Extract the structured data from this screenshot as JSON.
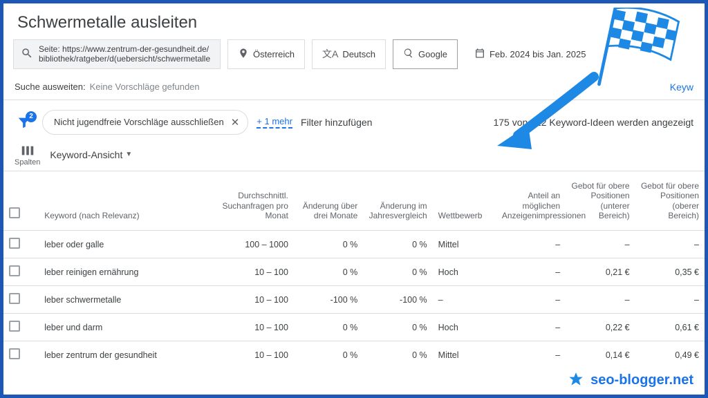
{
  "page_title": "Schwermetalle ausleiten",
  "filters": {
    "site_prefix": "Seite: ",
    "site_url": "https://www.zentrum-der-gesundheit.de/bibliothek/ratgeber/d(uebersicht/schwermetalle",
    "country": "Österreich",
    "language": "Deutsch",
    "network": "Google",
    "date_range": "Feb. 2024 bis Jan. 2025"
  },
  "expand": {
    "label": "Suche ausweiten:",
    "value": "Keine Vorschläge gefunden",
    "right_link": "Keyw"
  },
  "chips": {
    "funnel_count": "2",
    "adult_filter": "Nicht jugendfreie Vorschläge ausschließen",
    "more": "+ 1 mehr",
    "add_filter": "Filter hinzufügen",
    "count_text": "175 von 222 Keyword-Ideen werden angezeigt"
  },
  "view": {
    "columns_label": "Spalten",
    "dropdown_label": "Keyword-Ansicht"
  },
  "table": {
    "headers": {
      "keyword": "Keyword (nach Relevanz)",
      "volume": "Durchschnittl. Suchanfragen pro Monat",
      "change3m": "Änderung über drei Monate",
      "changeYoY": "Änderung im Jahresvergleich",
      "competition": "Wettbewerb",
      "impr_share": "Anteil an möglichen Anzeigenimpressionen",
      "bid_low": "Gebot für obere Positionen (unterer Bereich)",
      "bid_high": "Gebot für obere Positionen (oberer Bereich)"
    },
    "rows": [
      {
        "keyword": "leber oder galle",
        "volume": "100 – 1000",
        "change3m": "0 %",
        "changeYoY": "0 %",
        "competition": "Mittel",
        "impr_share": "–",
        "bid_low": "–",
        "bid_high": "–"
      },
      {
        "keyword": "leber reinigen ernährung",
        "volume": "10 – 100",
        "change3m": "0 %",
        "changeYoY": "0 %",
        "competition": "Hoch",
        "impr_share": "–",
        "bid_low": "0,21 €",
        "bid_high": "0,35 €"
      },
      {
        "keyword": "leber schwermetalle",
        "volume": "10 – 100",
        "change3m": "-100 %",
        "changeYoY": "-100 %",
        "competition": "–",
        "impr_share": "–",
        "bid_low": "–",
        "bid_high": "–"
      },
      {
        "keyword": "leber und darm",
        "volume": "10 – 100",
        "change3m": "0 %",
        "changeYoY": "0 %",
        "competition": "Hoch",
        "impr_share": "–",
        "bid_low": "0,22 €",
        "bid_high": "0,61 €"
      },
      {
        "keyword": "leber zentrum der gesundheit",
        "volume": "10 – 100",
        "change3m": "0 %",
        "changeYoY": "0 %",
        "competition": "Mittel",
        "impr_share": "–",
        "bid_low": "0,14 €",
        "bid_high": "0,49 €"
      }
    ]
  },
  "brand": "seo-blogger.net"
}
